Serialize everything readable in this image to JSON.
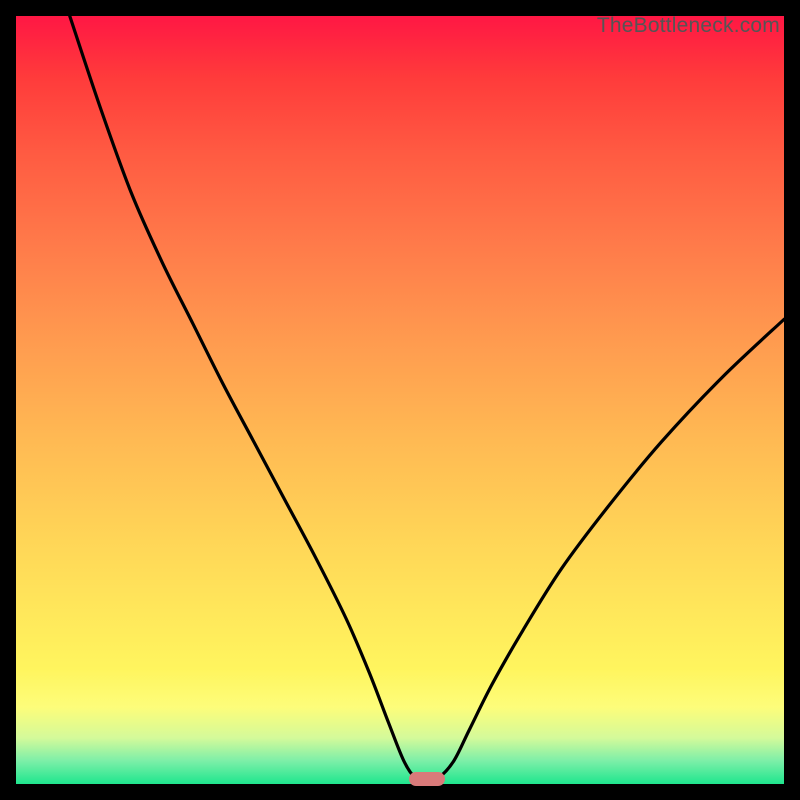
{
  "watermark": "TheBottleneck.com",
  "chart_data": {
    "type": "line",
    "title": "",
    "xlabel": "",
    "ylabel": "",
    "x_range": [
      0,
      100
    ],
    "y_range": [
      0,
      100
    ],
    "marker": {
      "x": 53.5,
      "y": 0.6,
      "color": "#d97a7a"
    },
    "series": [
      {
        "name": "bottleneck-curve",
        "color": "#000000",
        "points": [
          {
            "x": 7.0,
            "y": 100.0
          },
          {
            "x": 11.0,
            "y": 88.0
          },
          {
            "x": 15.0,
            "y": 77.0
          },
          {
            "x": 19.0,
            "y": 68.0
          },
          {
            "x": 23.0,
            "y": 60.0
          },
          {
            "x": 27.0,
            "y": 52.0
          },
          {
            "x": 31.0,
            "y": 44.5
          },
          {
            "x": 35.0,
            "y": 37.0
          },
          {
            "x": 39.0,
            "y": 29.5
          },
          {
            "x": 43.0,
            "y": 21.5
          },
          {
            "x": 46.0,
            "y": 14.5
          },
          {
            "x": 48.5,
            "y": 8.0
          },
          {
            "x": 50.5,
            "y": 3.0
          },
          {
            "x": 52.0,
            "y": 0.8
          },
          {
            "x": 53.5,
            "y": 0.5
          },
          {
            "x": 55.0,
            "y": 0.8
          },
          {
            "x": 57.0,
            "y": 3.0
          },
          {
            "x": 59.0,
            "y": 7.0
          },
          {
            "x": 62.0,
            "y": 13.0
          },
          {
            "x": 66.0,
            "y": 20.0
          },
          {
            "x": 71.0,
            "y": 28.0
          },
          {
            "x": 77.0,
            "y": 36.0
          },
          {
            "x": 84.0,
            "y": 44.5
          },
          {
            "x": 92.0,
            "y": 53.0
          },
          {
            "x": 100.0,
            "y": 60.5
          }
        ]
      }
    ]
  },
  "colors": {
    "curve": "#000000",
    "marker": "#d97a7a",
    "frame": "#000000"
  }
}
